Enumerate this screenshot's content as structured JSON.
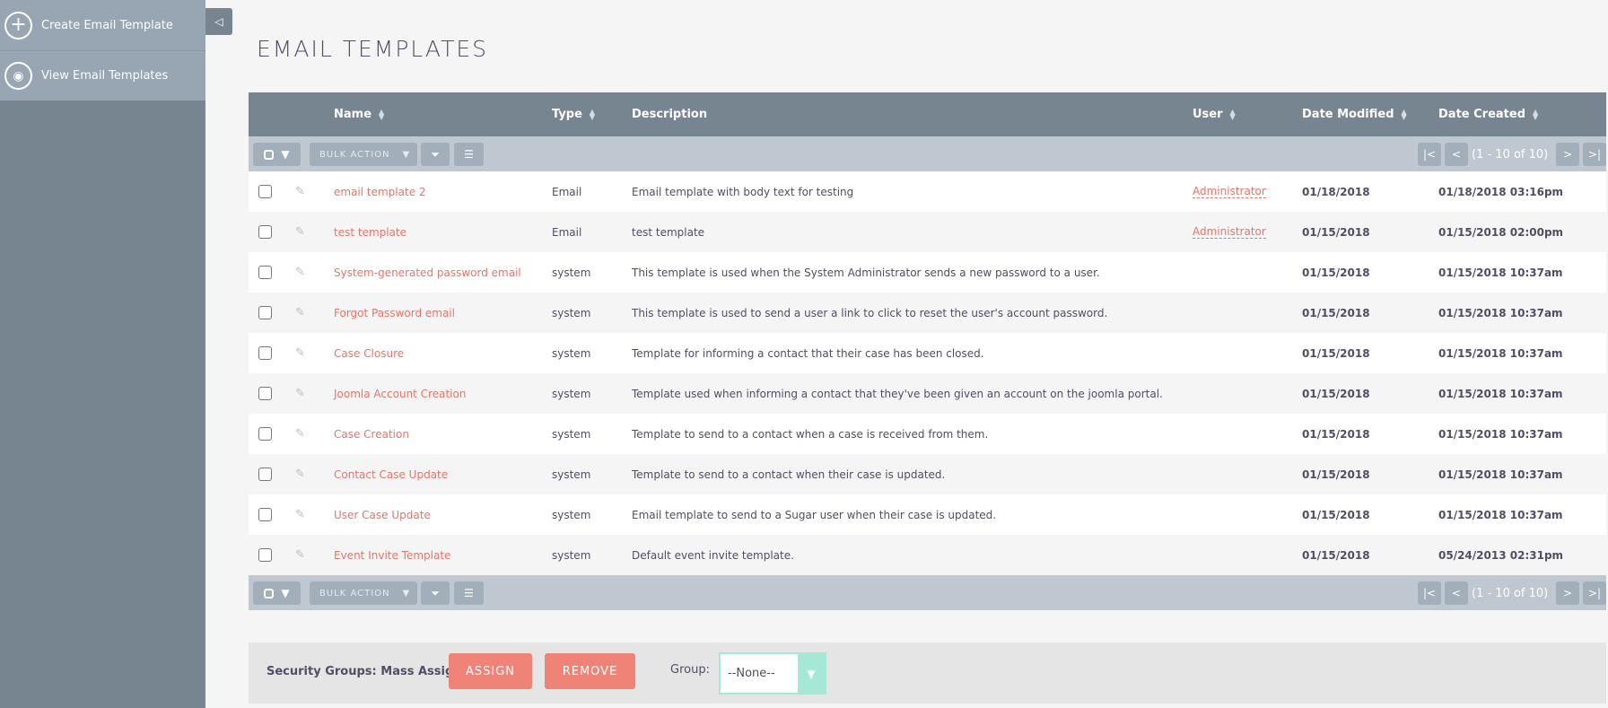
{
  "sidebar": {
    "actions": [
      {
        "label": "Create Email Template",
        "icon": "plus-icon"
      },
      {
        "label": "View Email Templates",
        "icon": "eye-icon"
      }
    ],
    "collapse_icon": "◁"
  },
  "page": {
    "title": "EMAIL TEMPLATES"
  },
  "table": {
    "columns": {
      "name": "Name",
      "type": "Type",
      "description": "Description",
      "user": "User",
      "date_modified": "Date Modified",
      "date_created": "Date Created"
    },
    "toolbar": {
      "bulk_action": "BULK ACTION",
      "pager_first": "|<",
      "pager_prev": "<",
      "pager_count": "(1 - 10 of 10)",
      "pager_next": ">",
      "pager_last": ">|"
    },
    "rows": [
      {
        "name": "email template 2",
        "type": "Email",
        "description": "Email template with body text for testing",
        "user": "Administrator",
        "date_modified": "01/18/2018",
        "date_created": "01/18/2018 03:16pm"
      },
      {
        "name": "test template",
        "type": "Email",
        "description": "test template",
        "user": "Administrator",
        "date_modified": "01/15/2018",
        "date_created": "01/15/2018 02:00pm"
      },
      {
        "name": "System-generated password email",
        "type": "system",
        "description": "This template is used when the System Administrator sends a new password to a user.",
        "user": "",
        "date_modified": "01/15/2018",
        "date_created": "01/15/2018 10:37am"
      },
      {
        "name": "Forgot Password email",
        "type": "system",
        "description": "This template is used to send a user a link to click to reset the user's account password.",
        "user": "",
        "date_modified": "01/15/2018",
        "date_created": "01/15/2018 10:37am"
      },
      {
        "name": "Case Closure",
        "type": "system",
        "description": "Template for informing a contact that their case has been closed.",
        "user": "",
        "date_modified": "01/15/2018",
        "date_created": "01/15/2018 10:37am"
      },
      {
        "name": "Joomla Account Creation",
        "type": "system",
        "description": "Template used when informing a contact that they've been given an account on the joomla portal.",
        "user": "",
        "date_modified": "01/15/2018",
        "date_created": "01/15/2018 10:37am"
      },
      {
        "name": "Case Creation",
        "type": "system",
        "description": "Template to send to a contact when a case is received from them.",
        "user": "",
        "date_modified": "01/15/2018",
        "date_created": "01/15/2018 10:37am"
      },
      {
        "name": "Contact Case Update",
        "type": "system",
        "description": "Template to send to a contact when their case is updated.",
        "user": "",
        "date_modified": "01/15/2018",
        "date_created": "01/15/2018 10:37am"
      },
      {
        "name": "User Case Update",
        "type": "system",
        "description": "Email template to send to a Sugar user when their case is updated.",
        "user": "",
        "date_modified": "01/15/2018",
        "date_created": "01/15/2018 10:37am"
      },
      {
        "name": "Event Invite Template",
        "type": "system",
        "description": "Default event invite template.",
        "user": "",
        "date_modified": "01/15/2018",
        "date_created": "05/24/2013 02:31pm"
      }
    ]
  },
  "mass_assign": {
    "label": "Security Groups: Mass Assign",
    "assign_label": "ASSIGN",
    "remove_label": "REMOVE",
    "group_label": "Group:",
    "group_value": "--None--"
  },
  "colors": {
    "sidebar": "#778591",
    "sidebar_actions": "#98a6b3",
    "header": "#778591",
    "link": "#e5766b",
    "button": "#f08377",
    "select_accent": "#a5e8d6"
  }
}
